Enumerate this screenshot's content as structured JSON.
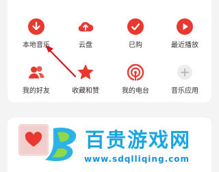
{
  "quick_menu": {
    "row1": [
      {
        "label": "本地音乐",
        "icon": "download-icon"
      },
      {
        "label": "云盘",
        "icon": "cloud-upload-icon"
      },
      {
        "label": "已购",
        "icon": "check-icon"
      },
      {
        "label": "最近播放",
        "icon": "play-icon"
      }
    ],
    "row2": [
      {
        "label": "我的好友",
        "icon": "friends-icon"
      },
      {
        "label": "收藏和赞",
        "icon": "star-icon"
      },
      {
        "label": "我的电台",
        "icon": "radio-icon"
      },
      {
        "label": "音乐应用",
        "icon": "plus-icon"
      }
    ]
  },
  "watermark": {
    "title": "百贵游戏网",
    "url": "www.sdqlliqing.com"
  },
  "colors": {
    "accent": "#e8382f",
    "gray_icon": "#e3e3e3",
    "watermark_blue": "#1aa4e6"
  }
}
